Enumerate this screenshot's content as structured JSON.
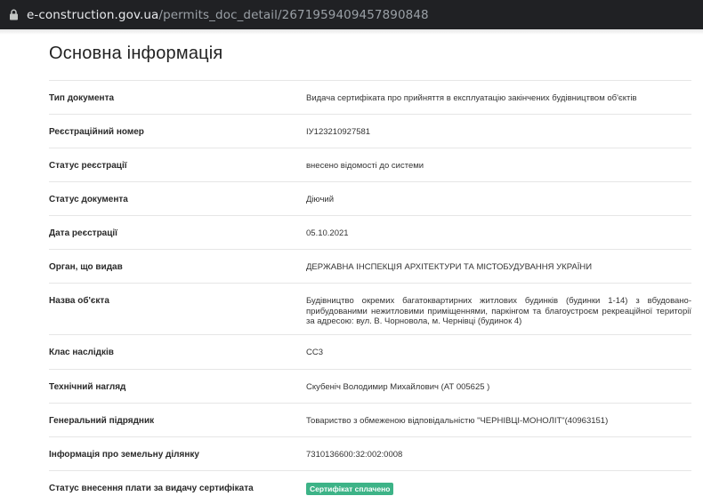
{
  "browser": {
    "domain": "e-construction.gov.ua",
    "path": "/permits_doc_detail/2671959409457890848"
  },
  "page_title": "Основна інформація",
  "rows": [
    {
      "label": "Тип документа",
      "value": "Видача сертифіката про прийняття в експлуатацію закінчених будівництвом об'єктів"
    },
    {
      "label": "Реєстраційний номер",
      "value": "ІУ123210927581"
    },
    {
      "label": "Статус реєстрації",
      "value": "внесено відомості до системи"
    },
    {
      "label": "Статус документа",
      "value": "Діючий"
    },
    {
      "label": "Дата реєстрації",
      "value": "05.10.2021"
    },
    {
      "label": "Орган, що видав",
      "value": "ДЕРЖАВНА ІНСПЕКЦІЯ АРХІТЕКТУРИ ТА МІСТОБУДУВАННЯ УКРАЇНИ"
    },
    {
      "label": "Назва об'єкта",
      "value": "Будівництво окремих багатоквартирних житлових будинків (будинки 1-14) з вбудовано-прибудованими нежитловими приміщеннями, паркінгом та благоустроєм рекреаційної території за адресою: вул. В. Чорновола, м. Чернівці (будинок 4)"
    },
    {
      "label": "Клас наслідків",
      "value": "СС3"
    },
    {
      "label": "Технічний нагляд",
      "value": "Скубеніч Володимир Михайлович (АТ 005625 )"
    },
    {
      "label": "Генеральний підрядник",
      "value": "Товариство з обмеженою відповідальністю \"ЧЕРНІВЦІ-МОНОЛІТ\"(40963151)"
    },
    {
      "label": "Інформація про земельну ділянку",
      "value": "7310136600:32:002:0008"
    },
    {
      "label": "Статус внесення плати за видачу сертифіката",
      "value": "Сертифікат сплачено"
    }
  ],
  "colors": {
    "badge": "#3db387",
    "addressbar_bg": "#202124"
  }
}
